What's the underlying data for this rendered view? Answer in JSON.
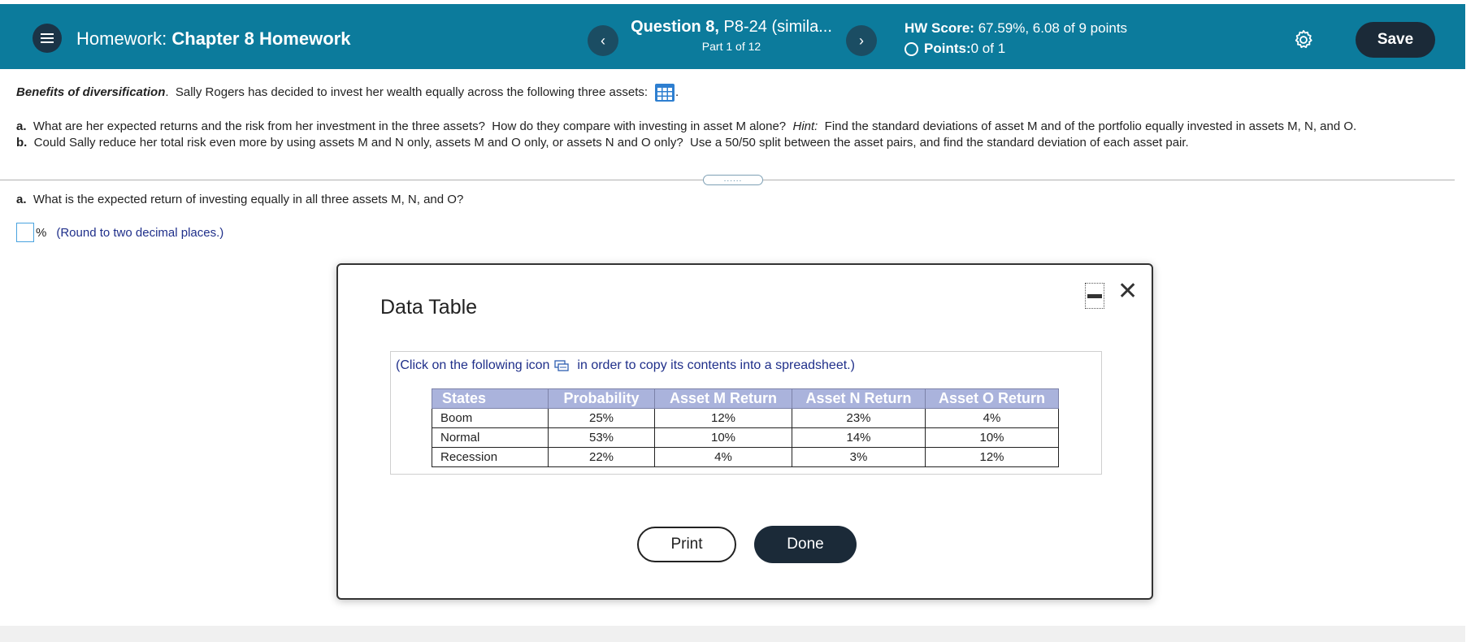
{
  "header": {
    "homework_prefix": "Homework:",
    "homework_name": "Chapter 8 Homework",
    "question_title_bold": "Question 8,",
    "question_title_rest": " P8-24 (simila...",
    "question_part": "Part 1 of 12",
    "hw_score_label": "HW Score:",
    "hw_score_value": " 67.59%, 6.08 of 9 points",
    "points_label": "Points:",
    "points_value": " 0 of 1",
    "save_label": "Save",
    "prev_glyph": "‹",
    "next_glyph": "›"
  },
  "question": {
    "topic": "Benefits of diversification",
    "intro": ".  Sally Rogers has decided to invest her wealth equally across the following three assets:",
    "intro_tail": ".",
    "part_a_label": "a.",
    "part_a_text": "  What are her expected returns and the risk from her investment in the three assets?  How do they compare with investing in asset M alone?  ",
    "part_a_hint_label": "Hint:",
    "part_a_hint_text": "  Find the standard deviations of asset M and of the portfolio equally invested in assets M, N, and O.",
    "part_b_label": "b.",
    "part_b_text": "  Could Sally reduce her total risk even more by using assets M and N only, assets M and O only, or assets N and O only?  Use a 50/50 split between the asset pairs, and find the standard deviation of each asset pair.",
    "handle_dots": "......"
  },
  "subquestion": {
    "label": "a.",
    "text": "  What is the expected return of investing equally in all three assets M, N, and O?",
    "unit": "%",
    "hint": "(Round to two decimal places.)",
    "answer_value": ""
  },
  "modal": {
    "title": "Data Table",
    "copy_note_before": "(Click on the following icon",
    "copy_note_after": "in order to copy its contents into a spreadsheet.)",
    "columns": [
      "States",
      "Probability",
      "Asset M Return",
      "Asset N Return",
      "Asset O Return"
    ],
    "rows": [
      [
        "Boom",
        "25%",
        "12%",
        "23%",
        "4%"
      ],
      [
        "Normal",
        "53%",
        "10%",
        "14%",
        "10%"
      ],
      [
        "Recession",
        "22%",
        "4%",
        "3%",
        "12%"
      ]
    ],
    "print_label": "Print",
    "done_label": "Done",
    "close_glyph": "✕"
  },
  "colors": {
    "header_bg": "#0c7b9c",
    "dark_button": "#1b2a38",
    "table_header_bg": "#aab3dc",
    "hint_text": "#1f2f8a"
  }
}
